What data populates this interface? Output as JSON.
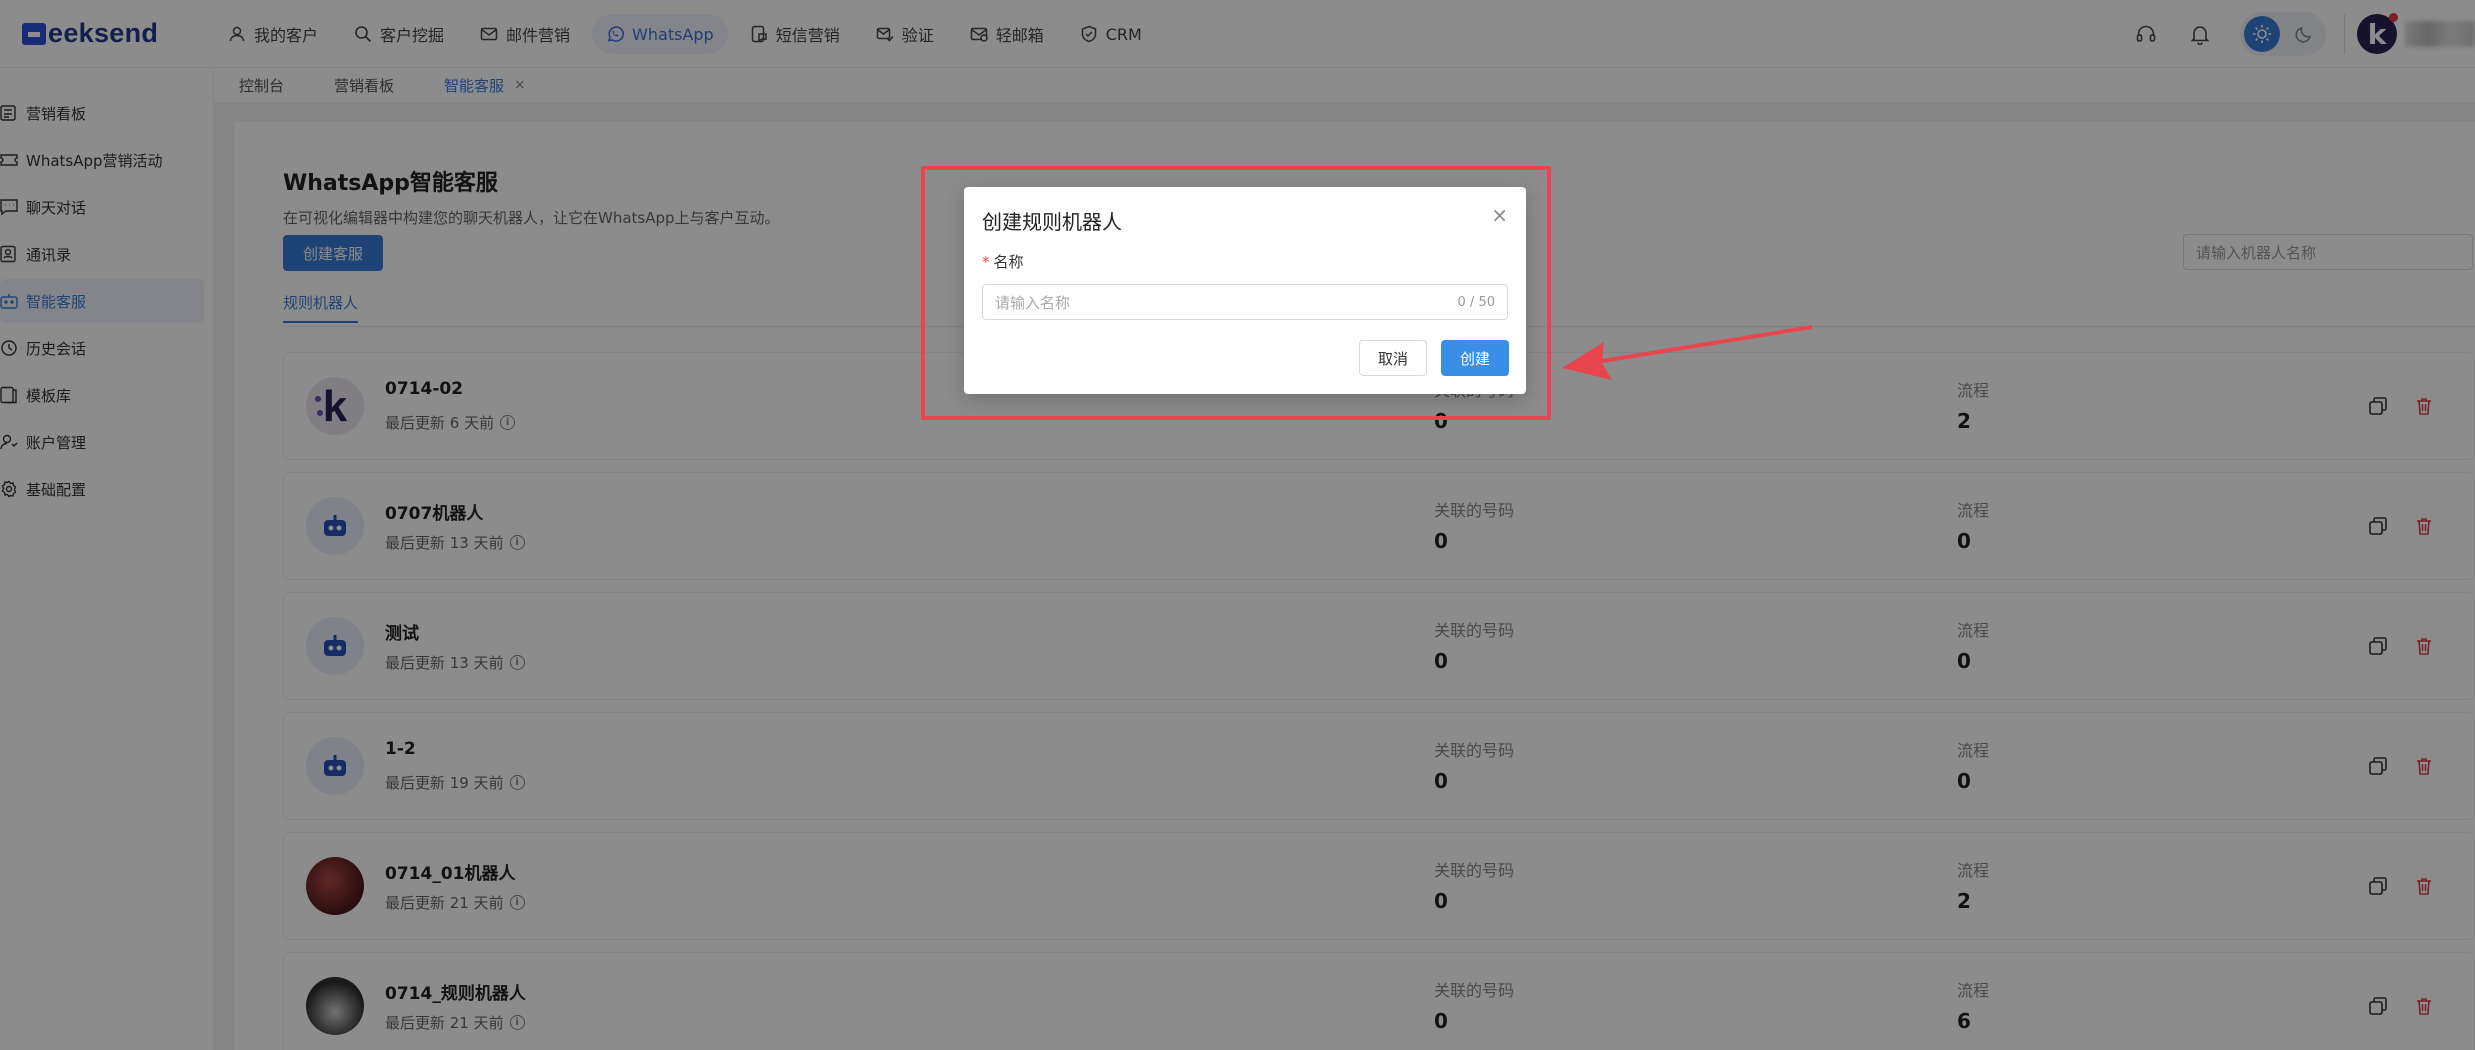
{
  "app": {
    "logo_text": "eeksend",
    "nav": [
      {
        "label": "我的客户",
        "icon": "user-icon"
      },
      {
        "label": "客户挖掘",
        "icon": "search-icon"
      },
      {
        "label": "邮件营销",
        "icon": "mail-icon"
      },
      {
        "label": "WhatsApp",
        "icon": "whatsapp-icon",
        "active": true
      },
      {
        "label": "短信营销",
        "icon": "sms-icon"
      },
      {
        "label": "验证",
        "icon": "verify-icon"
      },
      {
        "label": "轻邮箱",
        "icon": "light-mail-icon"
      },
      {
        "label": "CRM",
        "icon": "crm-icon"
      }
    ],
    "avatar_letter": "k"
  },
  "tabs": [
    {
      "label": "控制台"
    },
    {
      "label": "营销看板"
    },
    {
      "label": "智能客服",
      "active": true,
      "close": "×"
    }
  ],
  "sidebar": {
    "items": [
      {
        "label": "营销看板"
      },
      {
        "label": "WhatsApp营销活动"
      },
      {
        "label": "聊天对话"
      },
      {
        "label": "通讯录"
      },
      {
        "label": "智能客服",
        "active": true
      },
      {
        "label": "历史会话"
      },
      {
        "label": "模板库"
      },
      {
        "label": "账户管理"
      },
      {
        "label": "基础配置"
      }
    ]
  },
  "page": {
    "title": "WhatsApp智能客服",
    "subtitle": "在可视化编辑器中构建您的聊天机器人，让它在WhatsApp上与客户互动。",
    "create_button": "创建客服",
    "search_placeholder": "请输入机器人名称",
    "sub_tab": "规则机器人"
  },
  "robots": [
    {
      "name": "0714-02",
      "updated": "最后更新 6 天前",
      "linked_label": "关联的号码",
      "linked": "0",
      "flow_label": "流程",
      "flow": "2",
      "avatar": "k"
    },
    {
      "name": "0707机器人",
      "updated": "最后更新 13 天前",
      "linked_label": "关联的号码",
      "linked": "0",
      "flow_label": "流程",
      "flow": "0",
      "avatar": "bot"
    },
    {
      "name": "测试",
      "updated": "最后更新 13 天前",
      "linked_label": "关联的号码",
      "linked": "0",
      "flow_label": "流程",
      "flow": "0",
      "avatar": "bot"
    },
    {
      "name": "1-2",
      "updated": "最后更新 19 天前",
      "linked_label": "关联的号码",
      "linked": "0",
      "flow_label": "流程",
      "flow": "0",
      "avatar": "bot"
    },
    {
      "name": "0714_01机器人",
      "updated": "最后更新 21 天前",
      "linked_label": "关联的号码",
      "linked": "0",
      "flow_label": "流程",
      "flow": "2",
      "avatar": "photo1"
    },
    {
      "name": "0714_规则机器人",
      "updated": "最后更新 21 天前",
      "linked_label": "关联的号码",
      "linked": "0",
      "flow_label": "流程",
      "flow": "6",
      "avatar": "photo2"
    }
  ],
  "modal": {
    "title": "创建规则机器人",
    "field_required": "*",
    "field_label": "名称",
    "field_placeholder": "请输入名称",
    "field_counter": "0 / 50",
    "cancel": "取消",
    "create": "创建",
    "close": "×"
  },
  "colors": {
    "accent": "#3a7bd5",
    "highlight": "#e8454f",
    "delete": "#d64545"
  }
}
